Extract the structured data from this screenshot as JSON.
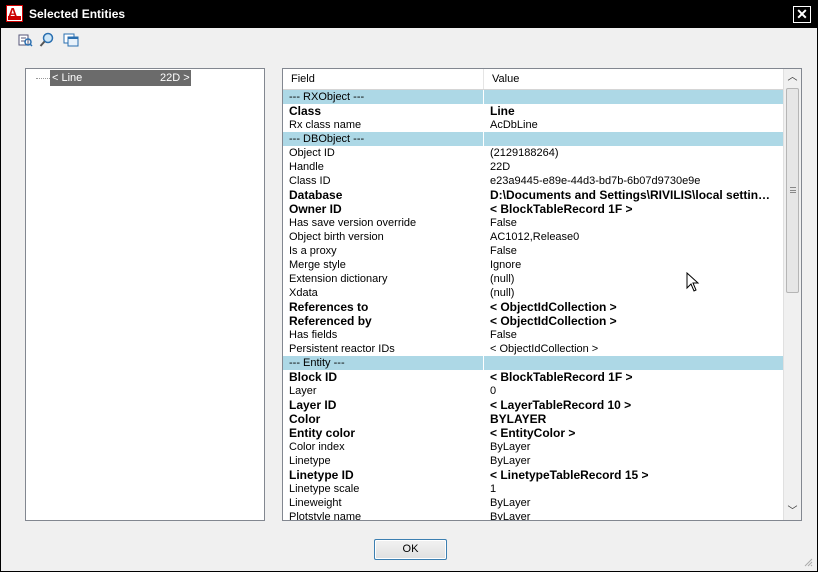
{
  "window": {
    "title": "Selected Entities",
    "app_icon_letter": "A"
  },
  "toolbar": {
    "buttons": [
      "inspect-icon",
      "zoom-icon",
      "window-icon"
    ]
  },
  "tree": {
    "item_name": "< Line",
    "item_handle": "22D >"
  },
  "grid": {
    "header_field": "Field",
    "header_value": "Value",
    "rows": [
      {
        "field": "--- RXObject ---",
        "value": "",
        "type": "section"
      },
      {
        "field": "Class",
        "value": " Line",
        "type": "bold"
      },
      {
        "field": "Rx class name",
        "value": "AcDbLine",
        "type": "normal"
      },
      {
        "field": "--- DBObject ---",
        "value": "",
        "type": "section"
      },
      {
        "field": "Object ID",
        "value": "(2129188264)",
        "type": "normal"
      },
      {
        "field": "Handle",
        "value": "22D",
        "type": "normal"
      },
      {
        "field": "Class ID",
        "value": "e23a9445-e89e-44d3-bd7b-6b07d9730e9e",
        "type": "normal"
      },
      {
        "field": "Database",
        "value": "D:\\Documents and Settings\\RIVILIS\\local settin…",
        "type": "bold"
      },
      {
        "field": "Owner ID",
        "value": "< BlockTableRecord         1F >",
        "type": "bold"
      },
      {
        "field": "Has save version override",
        "value": "False",
        "type": "normal"
      },
      {
        "field": "Object birth version",
        "value": "AC1012,Release0",
        "type": "normal"
      },
      {
        "field": "Is a proxy",
        "value": "False",
        "type": "normal"
      },
      {
        "field": "Merge style",
        "value": "Ignore",
        "type": "normal"
      },
      {
        "field": "Extension dictionary",
        "value": "(null)",
        "type": "normal"
      },
      {
        "field": "Xdata",
        "value": "(null)",
        "type": "normal"
      },
      {
        "field": "References to",
        "value": "< ObjectIdCollection >",
        "type": "bold"
      },
      {
        "field": "Referenced by",
        "value": "< ObjectIdCollection >",
        "type": "bold"
      },
      {
        "field": "Has fields",
        "value": "False",
        "type": "normal"
      },
      {
        "field": "Persistent reactor IDs",
        "value": "< ObjectIdCollection >",
        "type": "normal"
      },
      {
        "field": "--- Entity ---",
        "value": "",
        "type": "section"
      },
      {
        "field": "Block ID",
        "value": "< BlockTableRecord         1F >",
        "type": "bold"
      },
      {
        "field": "Layer",
        "value": "0",
        "type": "normal"
      },
      {
        "field": "Layer ID",
        "value": "< LayerTableRecord         10 >",
        "type": "bold"
      },
      {
        "field": "Color",
        "value": "BYLAYER",
        "type": "bold"
      },
      {
        "field": "Entity color",
        "value": "< EntityColor >",
        "type": "bold"
      },
      {
        "field": "Color index",
        "value": "ByLayer",
        "type": "normal"
      },
      {
        "field": "Linetype",
        "value": "ByLayer",
        "type": "normal"
      },
      {
        "field": "Linetype ID",
        "value": "< LinetypeTableRecord      15 >",
        "type": "bold"
      },
      {
        "field": "Linetype scale",
        "value": "1",
        "type": "normal"
      },
      {
        "field": "Lineweight",
        "value": "ByLayer",
        "type": "normal"
      },
      {
        "field": "Plotstyle name",
        "value": "ByLayer",
        "type": "normal"
      }
    ]
  },
  "buttons": {
    "ok_label": "OK"
  },
  "colors": {
    "section_bg": "#add8e6",
    "selection_bg": "#6b6b6b",
    "titlebar_bg": "#000000"
  }
}
